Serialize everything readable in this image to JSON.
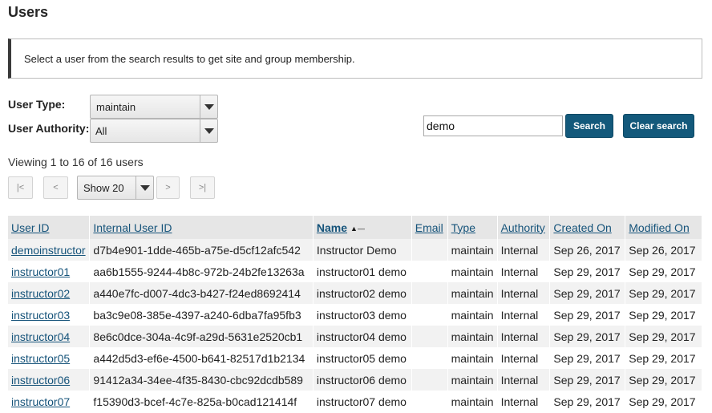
{
  "page": {
    "title": "Users"
  },
  "info": {
    "message": "Select a user from the search results to get site and group membership."
  },
  "filters": {
    "user_type_label": "User Type:",
    "user_type_value": "maintain",
    "user_authority_label": "User Authority:",
    "user_authority_value": "All"
  },
  "search": {
    "value": "demo",
    "search_label": "Search",
    "clear_label": "Clear search"
  },
  "pager": {
    "viewing_text": "Viewing 1 to 16 of 16 users",
    "first_label": "|<",
    "prev_label": "<",
    "page_size_value": "Show 20",
    "next_label": ">",
    "last_label": ">|"
  },
  "table": {
    "columns": [
      "User ID",
      "Internal User ID",
      "Name",
      "Email",
      "Type",
      "Authority",
      "Created On",
      "Modified On"
    ],
    "sorted_column": "Name",
    "rows": [
      [
        "demoinstructor",
        "d7b4e901-1dde-465b-a75e-d5cf12afc542",
        "Instructor Demo",
        "",
        "maintain",
        "Internal",
        "Sep 26, 2017",
        "Sep 26, 2017"
      ],
      [
        "instructor01",
        "aa6b1555-9244-4b8c-972b-24b2fe13263a",
        "instructor01 demo",
        "",
        "maintain",
        "Internal",
        "Sep 29, 2017",
        "Sep 29, 2017"
      ],
      [
        "instructor02",
        "a440e7fc-d007-4dc3-b427-f24ed8692414",
        "instructor02 demo",
        "",
        "maintain",
        "Internal",
        "Sep 29, 2017",
        "Sep 29, 2017"
      ],
      [
        "instructor03",
        "ba3c9e08-385e-4397-a240-6dba7fa95fb3",
        "instructor03 demo",
        "",
        "maintain",
        "Internal",
        "Sep 29, 2017",
        "Sep 29, 2017"
      ],
      [
        "instructor04",
        "8e6c0dce-304a-4c9f-a29d-5631e2520cb1",
        "instructor04 demo",
        "",
        "maintain",
        "Internal",
        "Sep 29, 2017",
        "Sep 29, 2017"
      ],
      [
        "instructor05",
        "a442d5d3-ef6e-4500-b641-82517d1b2134",
        "instructor05 demo",
        "",
        "maintain",
        "Internal",
        "Sep 29, 2017",
        "Sep 29, 2017"
      ],
      [
        "instructor06",
        "91412a34-34ee-4f35-8430-cbc92dcdb589",
        "instructor06 demo",
        "",
        "maintain",
        "Internal",
        "Sep 29, 2017",
        "Sep 29, 2017"
      ],
      [
        "instructor07",
        "f15390d3-bcef-4c7e-825a-b0cad121414f",
        "instructor07 demo",
        "",
        "maintain",
        "Internal",
        "Sep 29, 2017",
        "Sep 29, 2017"
      ]
    ]
  },
  "colors": {
    "primary": "#13597b",
    "link": "#15537a",
    "header_bg": "#e6e6e6",
    "stripe_bg": "#f2f2f2"
  }
}
